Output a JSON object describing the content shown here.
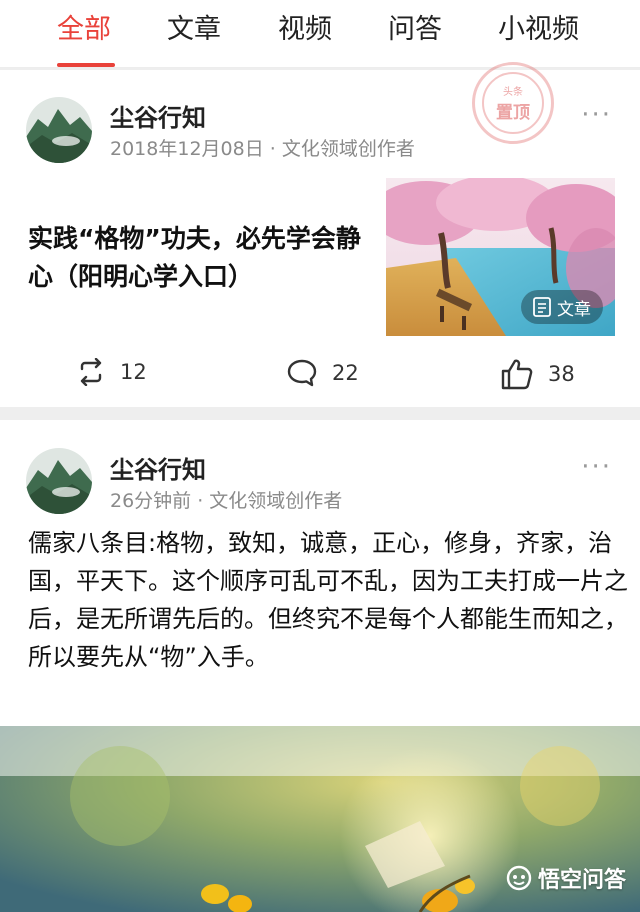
{
  "tabs": [
    {
      "label": "全部",
      "active": true
    },
    {
      "label": "文章",
      "active": false
    },
    {
      "label": "视频",
      "active": false
    },
    {
      "label": "问答",
      "active": false
    },
    {
      "label": "小视频",
      "active": false
    }
  ],
  "accent_color": "#e9423a",
  "post1": {
    "author": "尘谷行知",
    "meta": "2018年12月08日 · 文化领域创作者",
    "pinned_stamp": {
      "top": "头条",
      "main": "置顶"
    },
    "more_label": "···",
    "headline": "实践“格物”功夫，必先学会静心（阳明心学入口）",
    "thumb_badge": "文章",
    "thumb_badge_icon": "document-icon",
    "reposts": "12",
    "comments": "22",
    "likes": "38"
  },
  "post2": {
    "author": "尘谷行知",
    "meta": "26分钟前 · 文化领域创作者",
    "more_label": "···",
    "text": "儒家八条目:格物，致知，诚意，正心，修身，齐家，治国，平天下。这个顺序可乱可不乱，因为工夫打成一片之后，是无所谓先后的。但终究不是每个人都能生而知之，所以要先从“物”入手。"
  },
  "watermark": {
    "text": "悟空问答",
    "icon": "wukong-logo-icon"
  }
}
